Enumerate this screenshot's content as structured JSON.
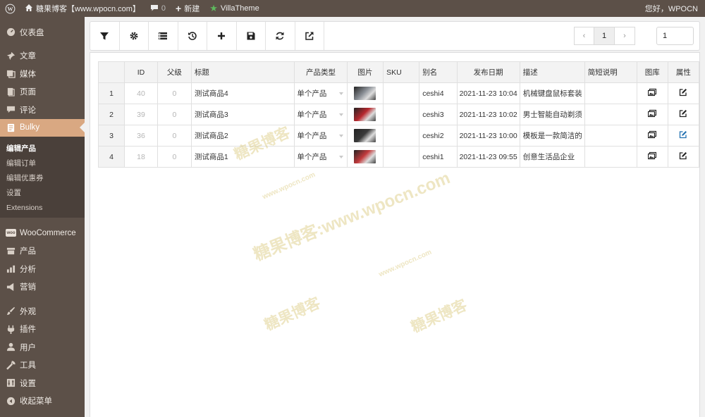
{
  "adminbar": {
    "site_title": "糖果博客【www.wpocn.com】",
    "comment_count": "0",
    "new_label": "新建",
    "plugin_label": "VillaTheme",
    "greeting": "您好，WPOCN"
  },
  "sidebar": {
    "items_top": [
      {
        "label": "仪表盘",
        "icon": "dashboard-icon"
      },
      {
        "label": "文章",
        "icon": "pin-icon"
      },
      {
        "label": "媒体",
        "icon": "media-icon"
      },
      {
        "label": "页面",
        "icon": "page-icon"
      },
      {
        "label": "评论",
        "icon": "comment-icon"
      },
      {
        "label": "Bulky",
        "icon": "bulky-icon"
      }
    ],
    "submenu": [
      {
        "label": "编辑产品"
      },
      {
        "label": "编辑订单"
      },
      {
        "label": "编辑优惠券"
      },
      {
        "label": "设置"
      },
      {
        "label": "Extensions"
      }
    ],
    "woo": {
      "label": "WooCommerce",
      "badge": "woo"
    },
    "items_mid": [
      {
        "label": "产品",
        "icon": "archive-icon"
      },
      {
        "label": "分析",
        "icon": "chart-icon"
      },
      {
        "label": "营销",
        "icon": "megaphone-icon"
      }
    ],
    "items_bottom": [
      {
        "label": "外观",
        "icon": "brush-icon"
      },
      {
        "label": "插件",
        "icon": "plugin-icon"
      },
      {
        "label": "用户",
        "icon": "user-icon"
      },
      {
        "label": "工具",
        "icon": "wrench-icon"
      },
      {
        "label": "设置",
        "icon": "settings-icon"
      },
      {
        "label": "收起菜单",
        "icon": "collapse-icon"
      }
    ]
  },
  "toolbar": {
    "buttons": [
      "filter-icon",
      "gear-icon",
      "columns-icon",
      "history-icon",
      "add-icon",
      "save-icon",
      "refresh-icon",
      "export-icon"
    ],
    "pager_prev": "‹",
    "pager_current": "1",
    "pager_next": "›",
    "page_input": "1"
  },
  "table": {
    "headers": [
      "",
      "ID",
      "父级",
      "标题",
      "产品类型",
      "图片",
      "SKU",
      "别名",
      "发布日期",
      "描述",
      "简短说明",
      "图库",
      "属性"
    ],
    "rows": [
      {
        "n": "1",
        "id": "40",
        "parent": "0",
        "title": "测试商品4",
        "type": "单个产品",
        "sku": "",
        "slug": "ceshi4",
        "date": "2021-11-23 10:04",
        "desc": "机械键盘鼠标套装",
        "short": "",
        "thumb_color": "#8a8f96"
      },
      {
        "n": "2",
        "id": "39",
        "parent": "0",
        "title": "测试商品3",
        "type": "单个产品",
        "sku": "",
        "slug": "ceshi3",
        "date": "2021-11-23 10:02",
        "desc": "男士智能自动剃须",
        "short": "",
        "thumb_color": "#b7282e"
      },
      {
        "n": "3",
        "id": "36",
        "parent": "0",
        "title": "测试商品2",
        "type": "单个产品",
        "sku": "",
        "slug": "ceshi2",
        "date": "2021-11-23 10:00",
        "desc": "模板是一款简洁的",
        "short": "",
        "thumb_color": "#3a3a3a"
      },
      {
        "n": "4",
        "id": "18",
        "parent": "0",
        "title": "测试商品1",
        "type": "单个产品",
        "sku": "",
        "slug": "ceshi1",
        "date": "2021-11-23 09:55",
        "desc": "创意生活品企业",
        "short": "",
        "thumb_color": "#c23a3c"
      }
    ]
  },
  "watermarks": [
    "糖果博客",
    "www.wpocn.com",
    "糖果博客:www.wpocn.com",
    "www.wpocn.com",
    "糖果博客",
    "糖果博客"
  ]
}
